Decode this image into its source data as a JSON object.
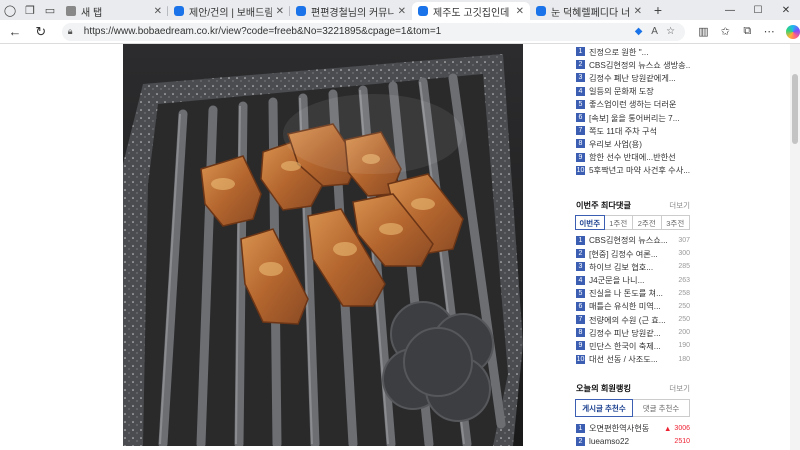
{
  "browser": {
    "tabs": [
      {
        "title": "새 탭",
        "favicon": "gray",
        "active": false
      },
      {
        "title": "제안/건의 | 보배드림 커뮤",
        "favicon": "blue",
        "active": false
      },
      {
        "title": "편편경철님의 커뮤니티 - 보",
        "favicon": "blue",
        "active": false
      },
      {
        "title": "제주도 고깃집인데 이거 이",
        "favicon": "blue",
        "active": true
      },
      {
        "title": "눈 덕혜렐페디다 너어게 뭔",
        "favicon": "blue",
        "active": false
      }
    ],
    "url": "https://www.bobaedream.co.kr/view?code=freeb&No=3221895&cpage=1&tom=1"
  },
  "sidebar": {
    "top_list": [
      {
        "rank": "1",
        "title": "진정으로 원한 \"..."
      },
      {
        "rank": "2",
        "title": "CBS김현정의 뉴스쇼 생방송..."
      },
      {
        "rank": "3",
        "title": "김정수 폐난 당원같에게..."
      },
      {
        "rank": "4",
        "title": "일등의 문화재 도장"
      },
      {
        "rank": "5",
        "title": "좋스업이런 생하는 더러운"
      },
      {
        "rank": "6",
        "title": "[속보] 울을 통어버리는 7..."
      },
      {
        "rank": "7",
        "title": "쪽도 11대 주차 구석"
      },
      {
        "rank": "8",
        "title": "우리보 사업(용)"
      },
      {
        "rank": "9",
        "title": "함한 선수 반대에...반한선"
      },
      {
        "rank": "10",
        "title": "5후짝년고 마약 사건후 수사..."
      }
    ],
    "weekly": {
      "title": "이번주 최다댓글",
      "more": "더보기",
      "tabs": [
        "이번주",
        "1주전",
        "2주전",
        "3주전"
      ],
      "items": [
        {
          "rank": "1",
          "title": "CBS김현정의 뉴스쇼...",
          "count": "307"
        },
        {
          "rank": "2",
          "title": "[현중] 김정수 여론...",
          "count": "300"
        },
        {
          "rank": "3",
          "title": "하이브 김보 협호...",
          "count": "285"
        },
        {
          "rank": "4",
          "title": "J4군문을 나니...",
          "count": "263"
        },
        {
          "rank": "5",
          "title": "진실을 나 돈도를 쳐...",
          "count": "258"
        },
        {
          "rank": "6",
          "title": "매틀슨 유식한 미역...",
          "count": "250"
        },
        {
          "rank": "7",
          "title": "전량에의 수원 (근 효...",
          "count": "250"
        },
        {
          "rank": "8",
          "title": "김정수 피난 당원같...",
          "count": "200"
        },
        {
          "rank": "9",
          "title": "민단스 한국이 축제...",
          "count": "190"
        },
        {
          "rank": "10",
          "title": "대선 선동 / 사조도...",
          "count": "180"
        }
      ]
    },
    "today": {
      "title": "오늘의 회원랭킹",
      "more": "더보기",
      "tabs": [
        "게시글 추천수",
        "댓글 추천수"
      ],
      "items": [
        {
          "rank": "1",
          "title": "오면편한역사현동",
          "count": "3006"
        },
        {
          "rank": "2",
          "title": "lueamso22",
          "count": "2510"
        }
      ]
    }
  }
}
